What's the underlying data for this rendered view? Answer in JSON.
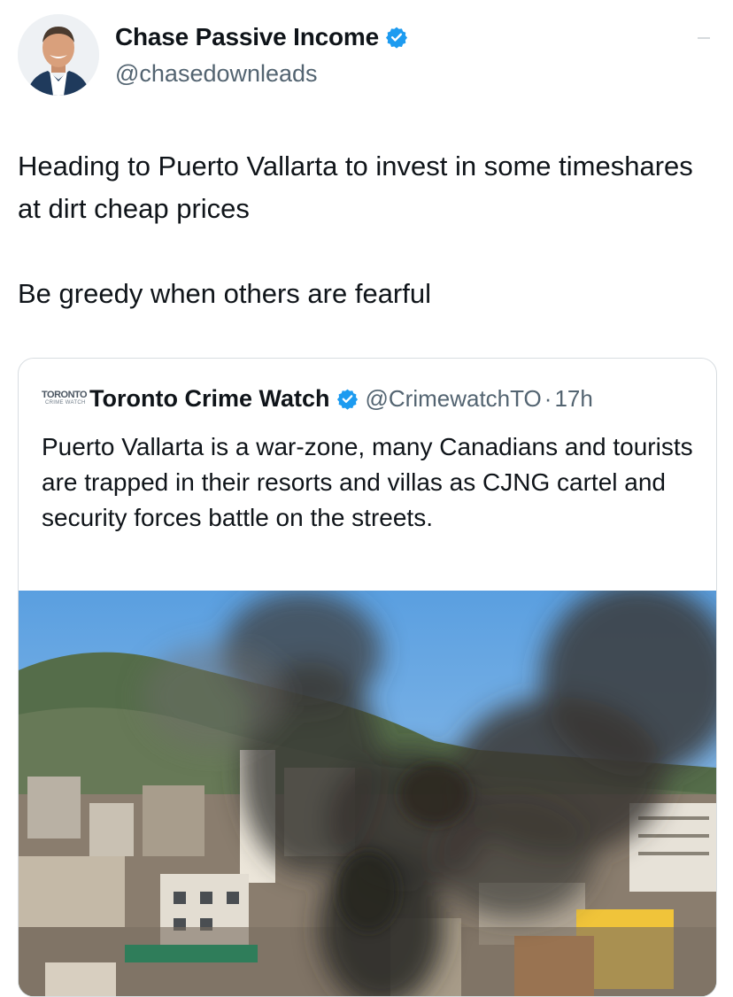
{
  "author": {
    "display_name": "Chase Passive Income",
    "handle": "@chasedownleads",
    "verified_icon": "verified-badge-icon"
  },
  "tweet": {
    "paragraphs": [
      "Heading to Puerto Vallarta to invest in some timeshares at dirt cheap prices",
      "Be greedy when others are fearful"
    ]
  },
  "quoted_tweet": {
    "logo_text_top": "TORONTO",
    "logo_text_bottom": "CRIME WATCH",
    "display_name": "Toronto Crime Watch",
    "handle": "@CrimewatchTO",
    "separator": "·",
    "time": "17h",
    "text": "Puerto Vallarta is a war-zone, many Canadians and tourists are trapped in their resorts and villas as CJNG cartel and security forces battle on the streets.",
    "image_subject": "smoke-over-city-photo"
  },
  "colors": {
    "verified_blue": "#1d9bf0",
    "text_primary": "#0f1419",
    "text_secondary": "#536471",
    "border": "#d8dde1"
  }
}
